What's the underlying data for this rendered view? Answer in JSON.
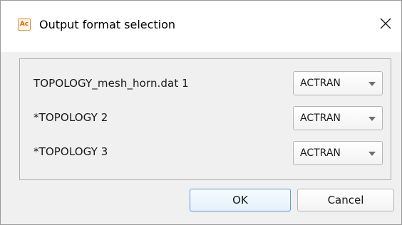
{
  "window": {
    "title": "Output format selection",
    "app_icon_text": "Ac",
    "close_icon": "close-icon"
  },
  "rows": [
    {
      "label": "TOPOLOGY_mesh_horn.dat 1",
      "format": "ACTRAN"
    },
    {
      "label": "*TOPOLOGY 2",
      "format": "ACTRAN"
    },
    {
      "label": "*TOPOLOGY 3",
      "format": "ACTRAN"
    }
  ],
  "buttons": {
    "ok": "OK",
    "cancel": "Cancel"
  },
  "colors": {
    "accent_border": "#5b9ad6",
    "icon_orange": "#e48a2a"
  }
}
